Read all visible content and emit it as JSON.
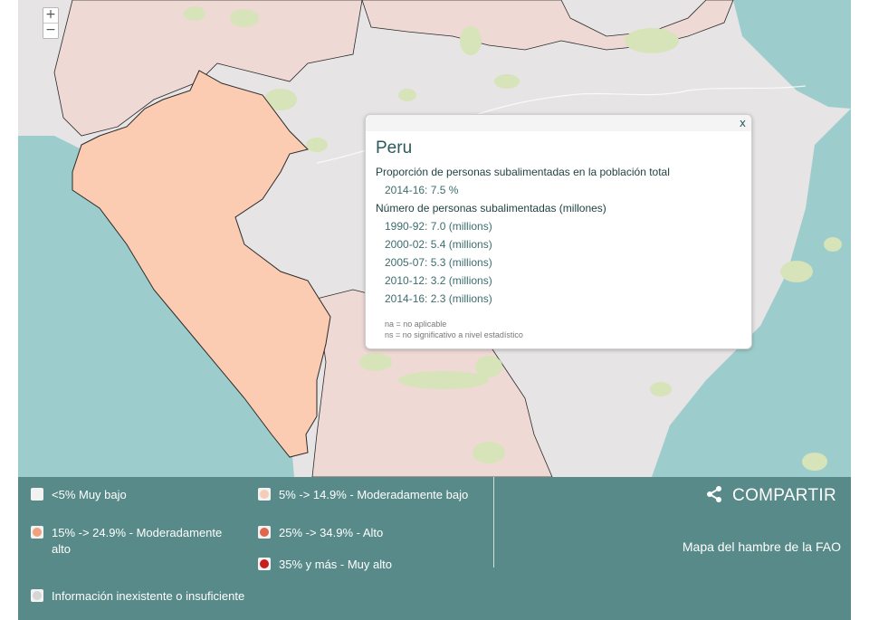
{
  "map": {
    "zoom_in_label": "+",
    "zoom_out_label": "−",
    "colors": {
      "sea": "#9ccdcc",
      "land_default": "#e6e4e4",
      "land_no_data": "#eeeaea",
      "peru_fill": "#fbcbb2",
      "neighbor_fill": "#efd9d5",
      "forest": "#d7e3b8",
      "border": "#2a2a2a"
    }
  },
  "popup": {
    "close_label": "x",
    "country": "Peru",
    "section1_title": "Proporción de personas subalimentadas en la población total",
    "section1_rows": [
      "2014-16: 7.5 %"
    ],
    "section2_title": "Número de personas subalimentadas (millones)",
    "section2_rows": [
      "1990-92: 7.0 (millions)",
      "2000-02: 5.4 (millions)",
      "2005-07: 5.3 (millions)",
      "2010-12: 3.2 (millions)",
      "2014-16: 2.3 (millions)"
    ],
    "note_na": "na = no aplicable",
    "note_ns": "ns = no significativo a nivel estadístico"
  },
  "legend": {
    "items": [
      {
        "label": "<5% Muy bajo",
        "color": "#f2f2f2"
      },
      {
        "label": "5% -> 14.9% - Moderadamente bajo",
        "color": "#f5cdb7"
      },
      {
        "label": "15% -> 24.9% - Moderadamente alto",
        "color": "#f0a27e"
      },
      {
        "label": "25% -> 34.9% - Alto",
        "color": "#e0664d"
      },
      {
        "label": "35% y más - Muy alto",
        "color": "#c81e1e"
      },
      {
        "label": "Información inexistente o insuficiente",
        "color": "#d6d6d6"
      }
    ],
    "share_label": "COMPARTIR",
    "fao_label": "Mapa del hambre de la FAO"
  }
}
